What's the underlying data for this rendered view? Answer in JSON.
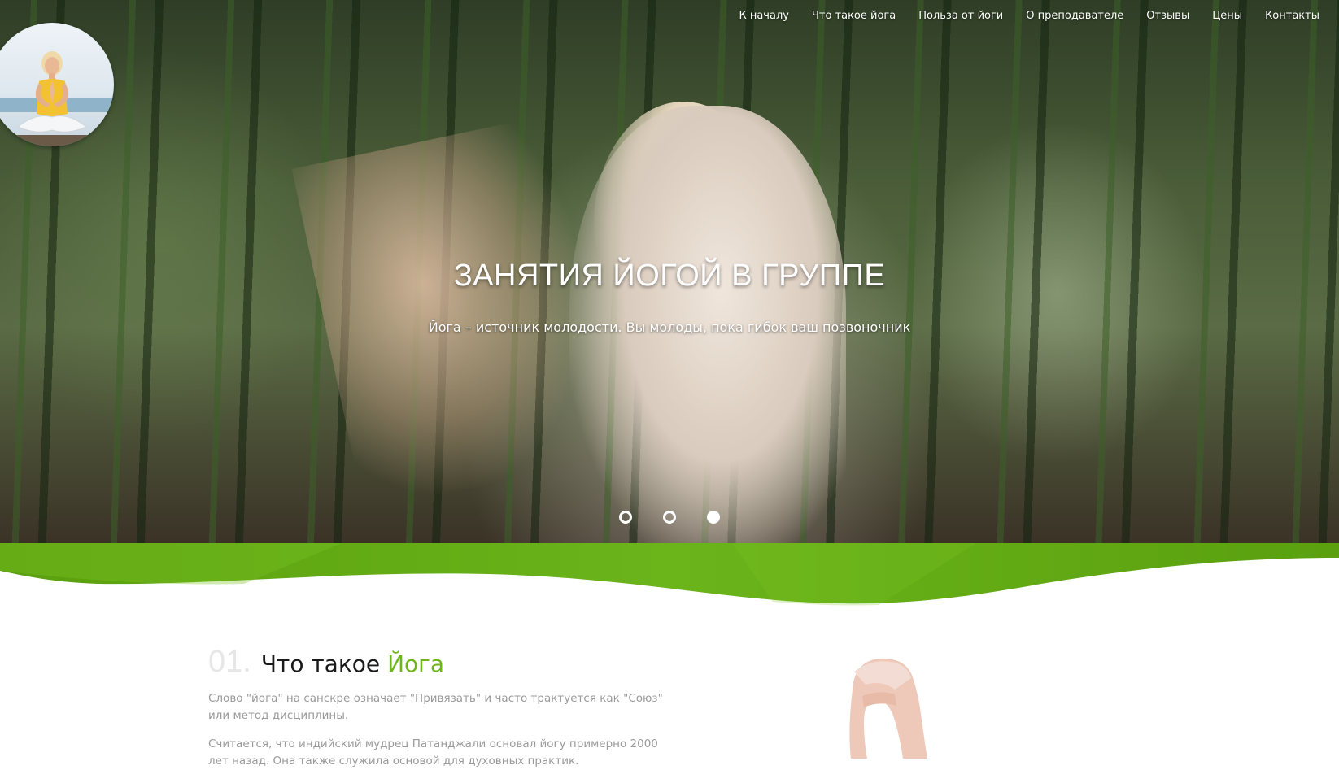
{
  "nav": {
    "items": [
      {
        "label": "К началу"
      },
      {
        "label": "Что такое йога"
      },
      {
        "label": "Польза от йоги"
      },
      {
        "label": "О преподавателе"
      },
      {
        "label": "Отзывы"
      },
      {
        "label": "Цены"
      },
      {
        "label": "Контакты"
      }
    ]
  },
  "hero": {
    "title": "ЗАНЯТИЯ ЙОГОЙ В ГРУППЕ",
    "subtitle": "Йога – источник молодости. Вы молоды, пока гибок ваш позвоночник",
    "slides_total": 3,
    "active_slide": 3
  },
  "section": {
    "number": "01.",
    "title": "Что такое",
    "title_accent": "Йога",
    "paragraphs": [
      "Слово \"йога\" на санскре означает \"Привязать\" и часто трактуется как \"Союз\" или метод дисциплины.",
      "Считается, что индийский мудрец Патанджали основал йогу примерно 2000 лет назад. Она также служила основой для духовных практик."
    ]
  },
  "colors": {
    "accent": "#6fb41c",
    "wave_dark": "#5aa00f",
    "wave_light": "#7cc322",
    "number_gray": "#e7e7e7",
    "text_gray": "#9a9a9a"
  },
  "icons": {
    "logo": "meditating-woman-avatar",
    "slider_dot": "circle-outline-icon"
  }
}
